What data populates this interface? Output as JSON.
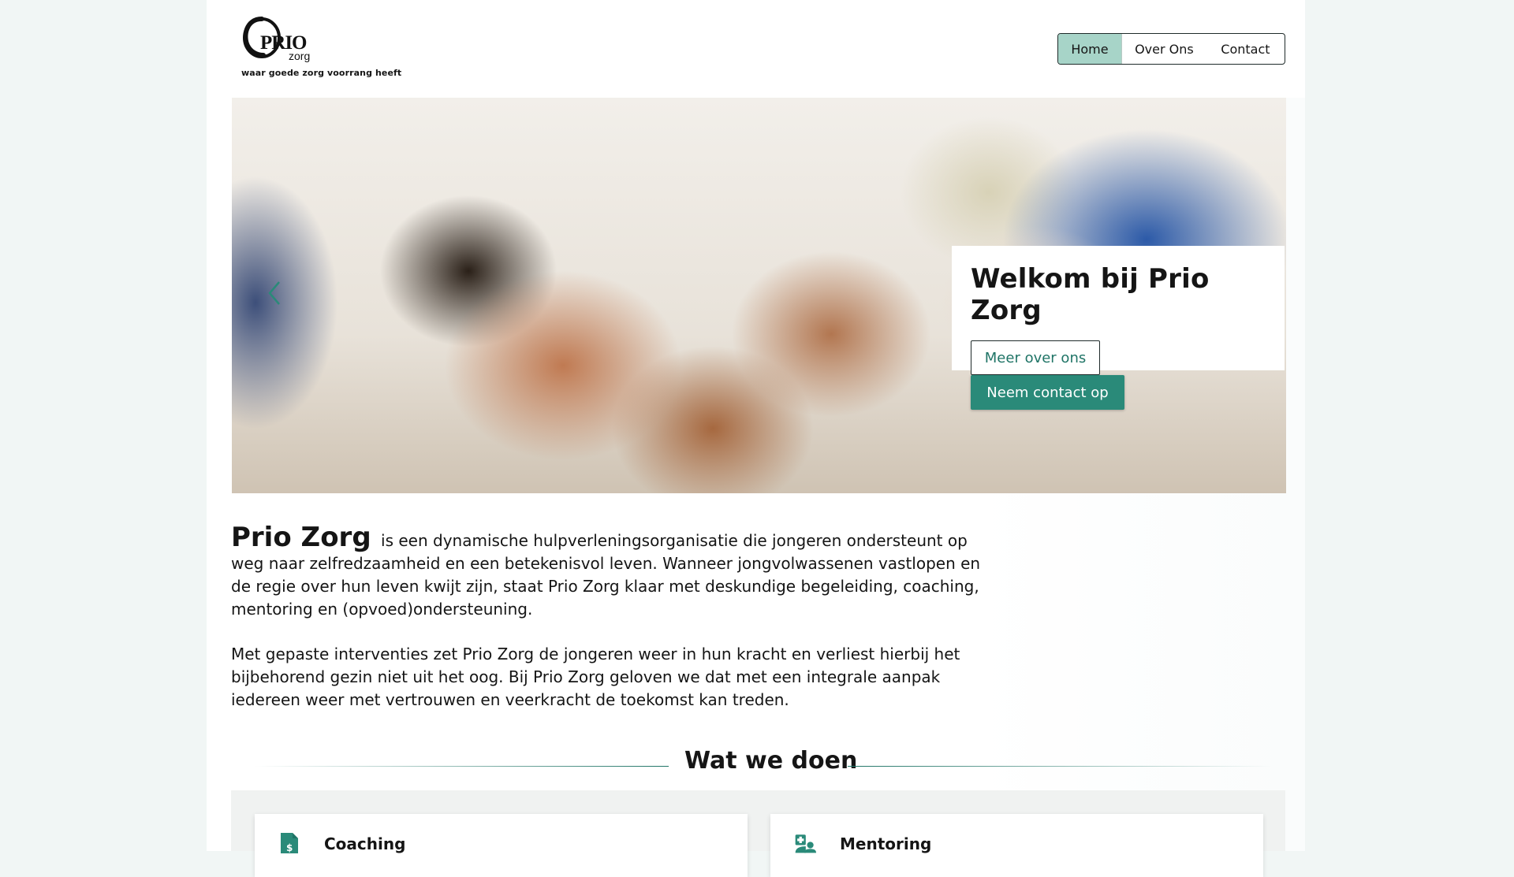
{
  "brand": {
    "logo_text": "PRIO",
    "logo_sub": "zorg",
    "tagline": "waar goede zorg voorrang heeft"
  },
  "nav": {
    "items": [
      {
        "label": "Home",
        "active": true
      },
      {
        "label": "Over Ons",
        "active": false
      },
      {
        "label": "Contact",
        "active": false
      }
    ]
  },
  "hero": {
    "title": "Welkom bij Prio Zorg",
    "btn_more": "Meer over ons",
    "btn_contact": "Neem contact op",
    "slides": 1,
    "active_slide": 1
  },
  "intro": {
    "brand": "Prio Zorg",
    "p1_rest": "is een dynamische hulpverleningsorganisatie die jongeren ondersteunt op weg naar zelfredzaamheid en een betekenisvol leven. Wanneer jongvolwassenen vastlopen en de regie over hun leven kwijt zijn, staat Prio Zorg klaar met deskundige begeleiding, coaching, mentoring en (opvoed)ondersteuning.",
    "p2": "Met gepaste interventies zet Prio Zorg de jongeren weer in hun kracht en verliest hierbij het bijbehorend gezin niet uit het oog. Bij Prio Zorg geloven we dat met een integrale aanpak iedereen weer met vertrouwen en veerkracht de toekomst kan treden."
  },
  "services": {
    "title": "Wat we doen",
    "items": [
      {
        "label": "Coaching",
        "icon": "invoice-dollar-icon"
      },
      {
        "label": "Mentoring",
        "icon": "user-medical-icon"
      }
    ]
  },
  "colors": {
    "accent": "#2a8a79",
    "accent_dark": "#1f7466",
    "nav_active": "#a7d4c8",
    "page_bg": "#f1f6f5"
  }
}
